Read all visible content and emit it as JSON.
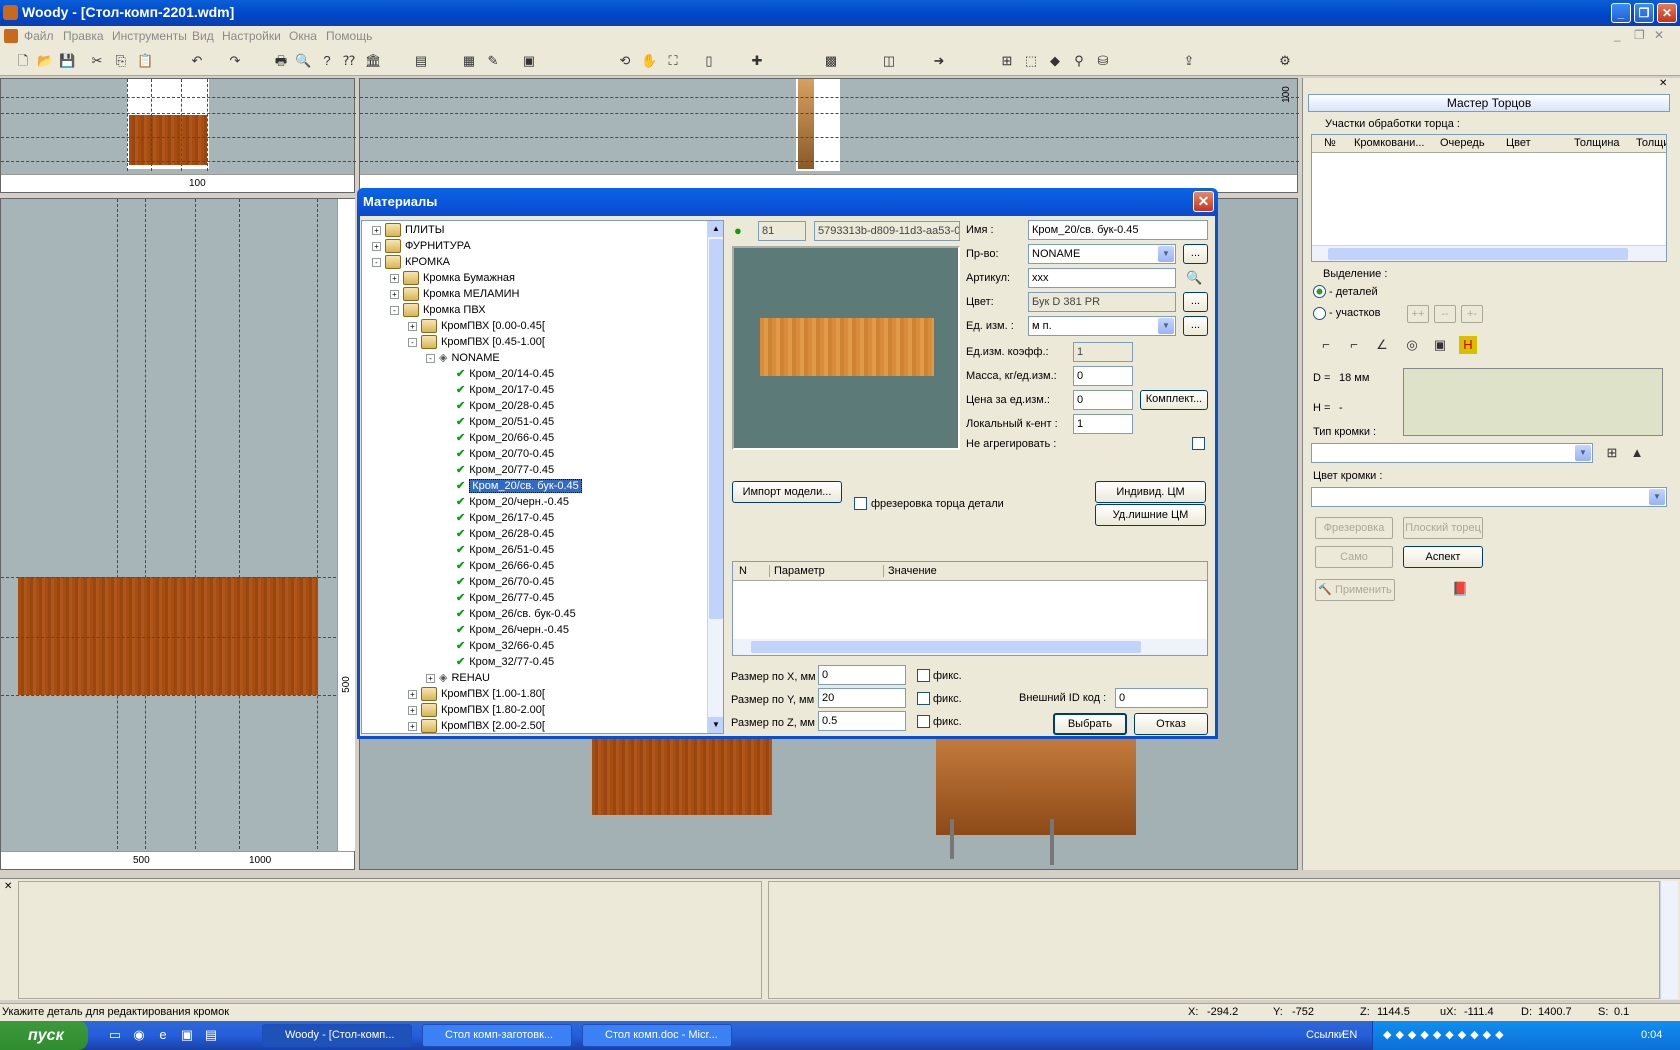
{
  "window": {
    "title": "Woody - [Стол-комп-2201.wdm]"
  },
  "menu": [
    "Файл",
    "Правка",
    "Инструменты",
    "Вид",
    "Настройки",
    "Окна",
    "Помощь"
  ],
  "top_left_pane": {
    "ruler_label": "100"
  },
  "left_pane": {
    "ruler_labels": [
      "500",
      "1000"
    ],
    "vruler_label": "500"
  },
  "top_mid_pane": {
    "vruler_label": "100"
  },
  "dialog": {
    "title": "Материалы",
    "id": "81",
    "guid": "5793313b-d809-11d3-aa53-0",
    "tree": [
      {
        "label": "ПЛИТЫ",
        "level": 0,
        "pm": "+",
        "type": "folder"
      },
      {
        "label": "ФУРНИТУРА",
        "level": 0,
        "pm": "+",
        "type": "folder"
      },
      {
        "label": "КРОМКА",
        "level": 0,
        "pm": "-",
        "type": "folder"
      },
      {
        "label": "Кромка Бумажная",
        "level": 1,
        "pm": "+",
        "type": "folder"
      },
      {
        "label": "Кромка МЕЛАМИН",
        "level": 1,
        "pm": "+",
        "type": "folder"
      },
      {
        "label": "Кромка ПВХ",
        "level": 1,
        "pm": "-",
        "type": "folder"
      },
      {
        "label": "КромПВХ [0.00-0.45[",
        "level": 2,
        "pm": "+",
        "type": "folder"
      },
      {
        "label": "КромПВХ [0.45-1.00[",
        "level": 2,
        "pm": "-",
        "type": "folder"
      },
      {
        "label": "NONAME",
        "level": 3,
        "pm": "-",
        "type": "maker"
      },
      {
        "label": "Кром_20/14-0.45",
        "level": 4,
        "type": "item"
      },
      {
        "label": "Кром_20/17-0.45",
        "level": 4,
        "type": "item"
      },
      {
        "label": "Кром_20/28-0.45",
        "level": 4,
        "type": "item"
      },
      {
        "label": "Кром_20/51-0.45",
        "level": 4,
        "type": "item"
      },
      {
        "label": "Кром_20/66-0.45",
        "level": 4,
        "type": "item"
      },
      {
        "label": "Кром_20/70-0.45",
        "level": 4,
        "type": "item"
      },
      {
        "label": "Кром_20/77-0.45",
        "level": 4,
        "type": "item"
      },
      {
        "label": "Кром_20/св. бук-0.45",
        "level": 4,
        "type": "item",
        "selected": true
      },
      {
        "label": "Кром_20/черн.-0.45",
        "level": 4,
        "type": "item"
      },
      {
        "label": "Кром_26/17-0.45",
        "level": 4,
        "type": "item"
      },
      {
        "label": "Кром_26/28-0.45",
        "level": 4,
        "type": "item"
      },
      {
        "label": "Кром_26/51-0.45",
        "level": 4,
        "type": "item"
      },
      {
        "label": "Кром_26/66-0.45",
        "level": 4,
        "type": "item"
      },
      {
        "label": "Кром_26/70-0.45",
        "level": 4,
        "type": "item"
      },
      {
        "label": "Кром_26/77-0.45",
        "level": 4,
        "type": "item"
      },
      {
        "label": "Кром_26/св. бук-0.45",
        "level": 4,
        "type": "item"
      },
      {
        "label": "Кром_26/черн.-0.45",
        "level": 4,
        "type": "item"
      },
      {
        "label": "Кром_32/66-0.45",
        "level": 4,
        "type": "item"
      },
      {
        "label": "Кром_32/77-0.45",
        "level": 4,
        "type": "item"
      },
      {
        "label": "REHAU",
        "level": 3,
        "pm": "+",
        "type": "maker"
      },
      {
        "label": "КромПВХ [1.00-1.80[",
        "level": 2,
        "pm": "+",
        "type": "folder"
      },
      {
        "label": "КромПВХ [1.80-2.00[",
        "level": 2,
        "pm": "+",
        "type": "folder"
      },
      {
        "label": "КромПВХ [2.00-2.50[",
        "level": 2,
        "pm": "+",
        "type": "folder"
      }
    ],
    "fields": {
      "name_label": "Имя :",
      "name": "Кром_20/св. бук-0.45",
      "maker_label": "Пр-во:",
      "maker": "NONAME",
      "article_label": "Артикул:",
      "article": "xxx",
      "color_label": "Цвет:",
      "color": "Бук D 381 PR",
      "unit_label": "Ед. изм. :",
      "unit": "м п.",
      "unit_coef_label": "Ед.изм. коэфф.:",
      "unit_coef": "1",
      "mass_label": "Масса, кг/ед.изм.:",
      "mass": "0",
      "price_label": "Цена за ед.изм.:",
      "price": "0",
      "local_coef_label": "Локальный к-ент :",
      "local_coef": "1",
      "no_aggregate_label": "Не агрегировать :"
    },
    "buttons": {
      "dots": "...",
      "komplekt": "Комплект...",
      "import": "Импорт модели...",
      "individ": "Индивид. ЦМ",
      "del_extra": "Уд.лишние ЦМ",
      "select": "Выбрать",
      "cancel": "Отказ"
    },
    "milling_label": "фрезеровка торца детали",
    "param_table": {
      "columns": [
        "N",
        "Параметр",
        "Значение"
      ]
    },
    "size_x_label": "Размер по X, мм",
    "size_x": "0",
    "size_y_label": "Размер по Y, мм",
    "size_y": "20",
    "size_z_label": "Размер по Z, мм",
    "size_z": "0.5",
    "fix_label": "фикс.",
    "ext_id_label": "Внешний ID код :",
    "ext_id": "0"
  },
  "right_panel": {
    "title": "Мастер Торцов",
    "section": "Участки обработки торца :",
    "columns": [
      "№",
      "Кромковани...",
      "Очередь",
      "Цвет",
      "Толщина",
      "Толщи"
    ],
    "selection_label": "Выделение :",
    "radio_parts": "- деталей",
    "radio_sections": "- участков",
    "small_btns": [
      "++",
      "--",
      "+-"
    ],
    "d_label": "D =",
    "d_value": "18 мм",
    "h_label": "H =",
    "h_value": "-",
    "edge_type_label": "Тип кромки :",
    "edge_color_label": "Цвет кромки :",
    "btn_milling": "Фрезеровка",
    "btn_flat": "Плоский торец",
    "btn_samo": "Само",
    "btn_aspect": "Аспект",
    "btn_apply": "Применить"
  },
  "status": {
    "hint": "Укажите деталь для редактирования кромок",
    "x_label": "X:",
    "x": "-294.2",
    "y_label": "Y:",
    "y": "-752",
    "z_label": "Z:",
    "z": "1144.5",
    "ux_label": "uX:",
    "ux": "-111.4",
    "d_label": "D:",
    "d": "1400.7",
    "s_label": "S:",
    "s": "0.1"
  },
  "taskbar": {
    "start": "пуск",
    "tasks": [
      "Woody - [Стол-комп...",
      "Стол комп-заготовк...",
      "Стол комп.doc - Micr..."
    ],
    "links": "Ссылки",
    "lang": "EN",
    "clock": "0:04"
  },
  "colors": {
    "accent": "#0a5ed8",
    "wood": "#a64d12",
    "selection": "#316ac5"
  }
}
